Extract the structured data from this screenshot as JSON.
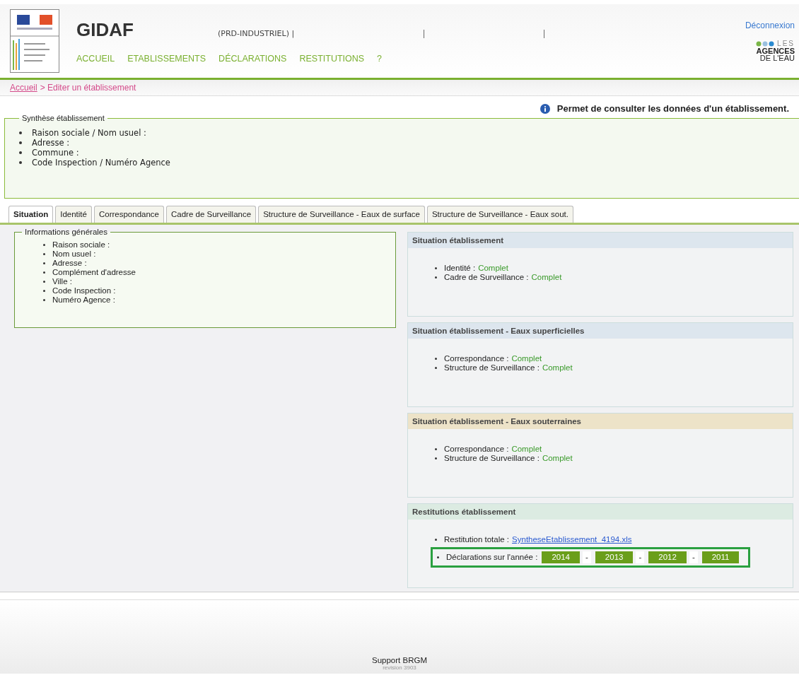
{
  "header": {
    "title": "GIDAF",
    "user_info": "(PRD-INDUSTRIEL) |",
    "separators": [
      "|",
      "|"
    ],
    "logout": "Déconnexion",
    "agency_logo": [
      "LES",
      "AGENCES",
      "DE L'EAU"
    ]
  },
  "nav": [
    {
      "label": "ACCUEIL"
    },
    {
      "label": "ETABLISSEMENTS"
    },
    {
      "label": "DÉCLARATIONS"
    },
    {
      "label": "RESTITUTIONS"
    },
    {
      "label": "?"
    }
  ],
  "breadcrumb": {
    "link": "Accueil",
    "current": "> Editer un établissement"
  },
  "info_message": "Permet de consulter les données d'un établissement.",
  "synthese": {
    "title": "Synthèse établissement",
    "items": [
      "Raison sociale / Nom usuel :",
      "Adresse :",
      "Commune :",
      "Code Inspection / Numéro Agence"
    ]
  },
  "tabs": [
    {
      "label": "Situation",
      "selected": true
    },
    {
      "label": "Identité",
      "selected": false
    },
    {
      "label": "Correspondance",
      "selected": false
    },
    {
      "label": "Cadre de Surveillance",
      "selected": false
    },
    {
      "label": "Structure de Surveillance - Eaux de surface",
      "selected": false
    },
    {
      "label": "Structure de Surveillance - Eaux sout.",
      "selected": false
    }
  ],
  "general_info": {
    "title": "Informations générales",
    "items": [
      "Raison sociale :",
      "Nom usuel :",
      "Adresse :",
      "Complément d'adresse",
      "Ville :",
      "Code Inspection :",
      "Numéro Agence :"
    ]
  },
  "panels": [
    {
      "title": "Situation établissement",
      "color": "#dde6ee",
      "kind": "status",
      "items": [
        {
          "label": "Identité :",
          "value": "Complet"
        },
        {
          "label": "Cadre de Surveillance :",
          "value": "Complet"
        }
      ]
    },
    {
      "title": "Situation établissement - Eaux superficielles",
      "color": "#dde6ee",
      "kind": "status",
      "items": [
        {
          "label": "Correspondance :",
          "value": "Complet"
        },
        {
          "label": "Structure de Surveillance :",
          "value": "Complet"
        }
      ]
    },
    {
      "title": "Situation établissement - Eaux souterraines",
      "color": "#ede3c8",
      "kind": "status",
      "items": [
        {
          "label": "Correspondance :",
          "value": "Complet"
        },
        {
          "label": "Structure de Surveillance :",
          "value": "Complet"
        }
      ]
    },
    {
      "title": "Restitutions établissement",
      "color": "#dcebe2",
      "kind": "restitution",
      "file_label": "Restitution totale :",
      "file_link": "SyntheseEtablissement_4194.xls",
      "years_label": "Déclarations sur l'année :",
      "years_highlighted": true,
      "years": [
        "2014",
        "2013",
        "2012",
        "2011"
      ],
      "year_separator": "-"
    }
  ],
  "footer": {
    "support": "Support BRGM",
    "revision": "revision 3903"
  }
}
